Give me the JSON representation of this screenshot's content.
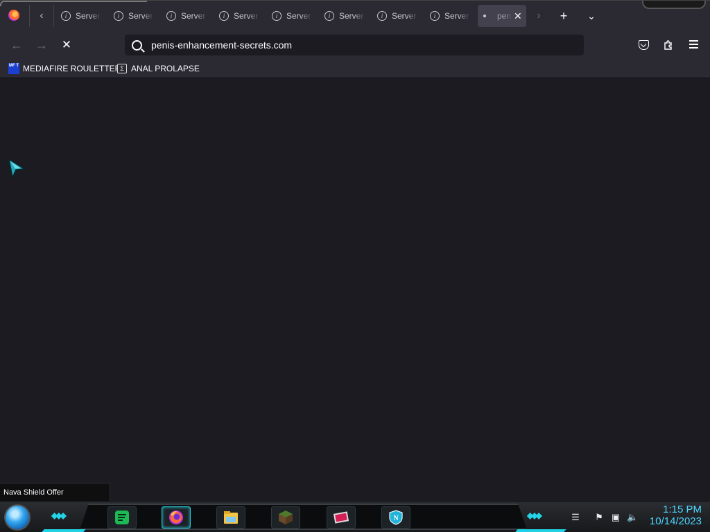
{
  "browser": {
    "tabs": [
      {
        "label": "Server",
        "icon": "info-icon"
      },
      {
        "label": "Server",
        "icon": "info-icon"
      },
      {
        "label": "Server",
        "icon": "info-icon"
      },
      {
        "label": "Server",
        "icon": "info-icon"
      },
      {
        "label": "Server",
        "icon": "info-icon"
      },
      {
        "label": "Server",
        "icon": "info-icon"
      },
      {
        "label": "Server",
        "icon": "info-icon"
      },
      {
        "label": "Server",
        "icon": "info-icon"
      }
    ],
    "active_tab": {
      "label": "pen",
      "loading": true
    },
    "url": "penis-enhancement-secrets.com",
    "bookmarks": [
      {
        "label": "MEDIAFIRE ROULETTER",
        "favicon_text": "MF T"
      },
      {
        "label": "ANAL PROLAPSE",
        "favicon_text": "Σ"
      }
    ]
  },
  "status_tooltip": "Nava Shield Offer",
  "taskbar": {
    "apps": [
      "note-app-icon",
      "firefox-icon",
      "file-explorer-icon",
      "minecraft-icon",
      "image-app-icon",
      "nava-shield-icon"
    ],
    "tray": [
      "flag-icon",
      "network-icon",
      "volume-icon"
    ],
    "time": "1:15 PM",
    "date": "10/14/2023"
  },
  "colors": {
    "accent": "#24d3e6",
    "chrome": "#2b2a33",
    "content": "#1c1b22",
    "clock": "#4fd6ff"
  }
}
